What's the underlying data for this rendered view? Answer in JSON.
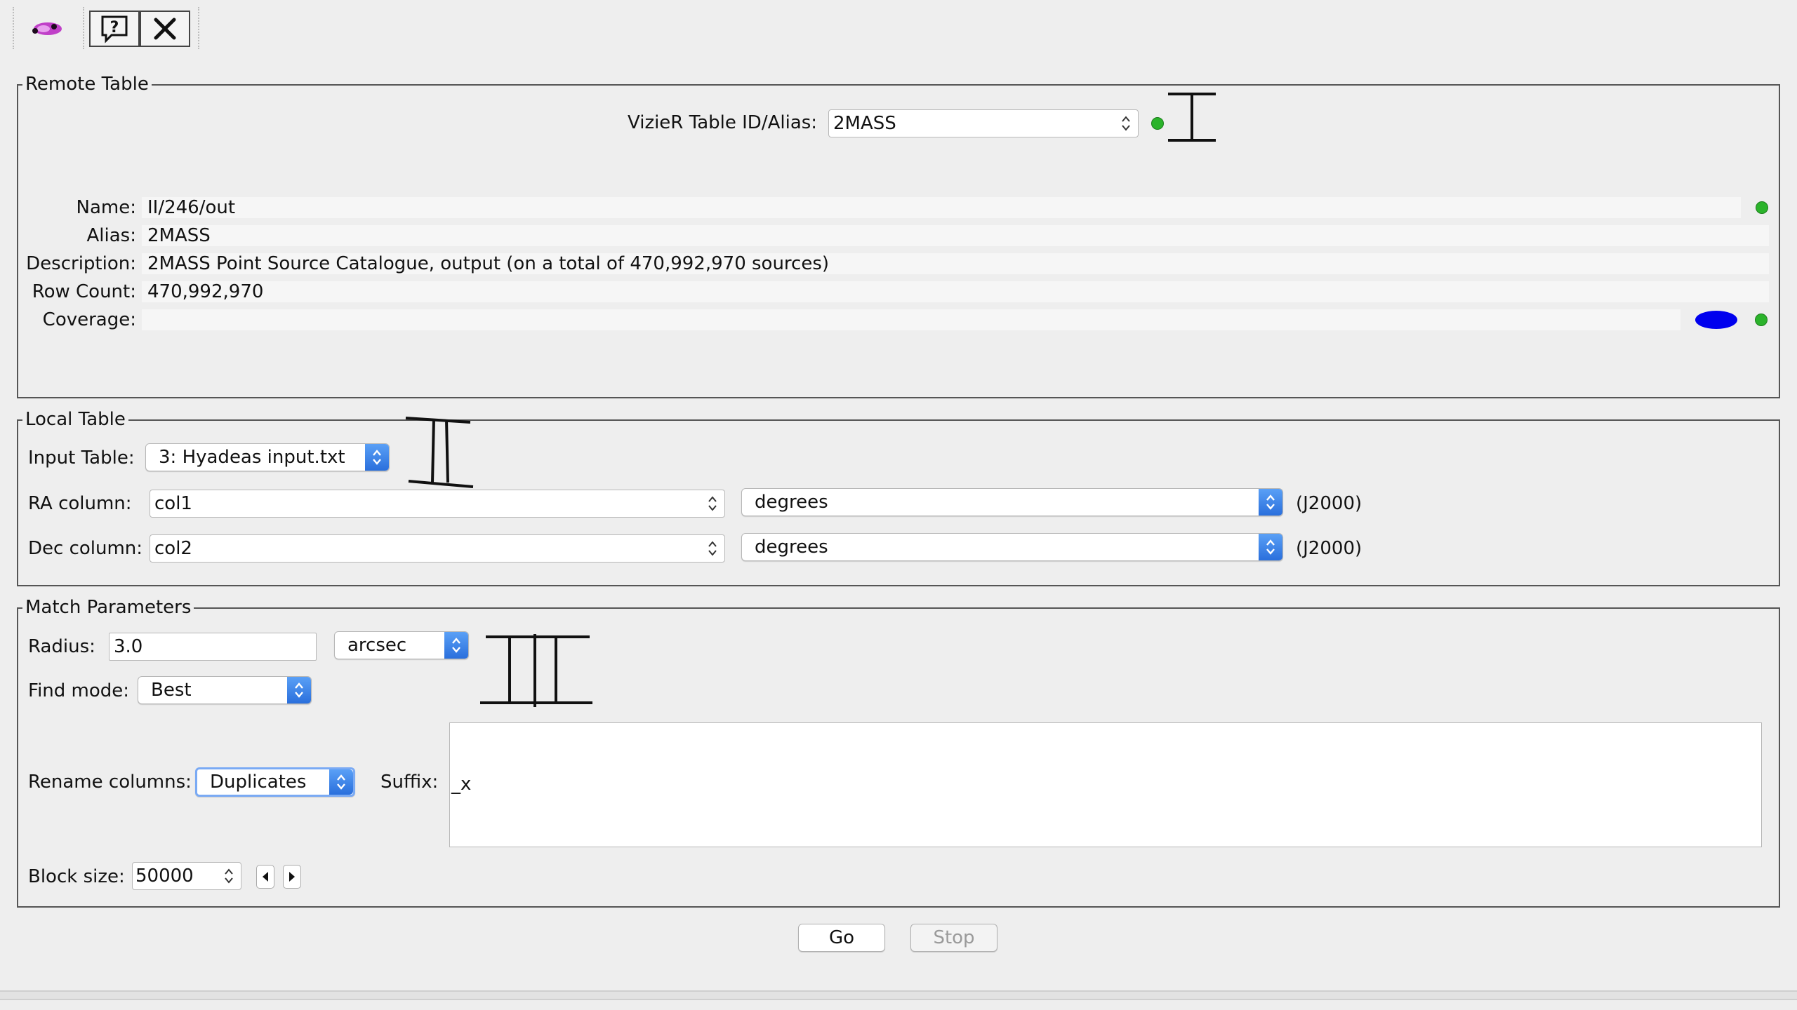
{
  "toolbar": {
    "logo_icon": "topcat-logo-icon",
    "help_icon": "help-icon",
    "close_icon": "close-icon"
  },
  "remote_table": {
    "legend": "Remote Table",
    "id_label": "VizieR Table ID/Alias:",
    "id_value": "2MASS",
    "name_label": "Name:",
    "name_value": "II/246/out",
    "alias_label": "Alias:",
    "alias_value": "2MASS",
    "description_label": "Description:",
    "description_value": "2MASS Point Source Catalogue, output (on a total of 470,992,970 sources)",
    "row_count_label": "Row Count:",
    "row_count_value": "470,992,970",
    "coverage_label": "Coverage:",
    "coverage_value": ""
  },
  "local_table": {
    "legend": "Local Table",
    "input_label": "Input Table:",
    "input_value": "3: Hyadeas input.txt",
    "ra_label": "RA column:",
    "ra_value": "col1",
    "ra_unit": "degrees",
    "ra_epoch": "(J2000)",
    "dec_label": "Dec column:",
    "dec_value": "col2",
    "dec_unit": "degrees",
    "dec_epoch": "(J2000)"
  },
  "match": {
    "legend": "Match Parameters",
    "radius_label": "Radius:",
    "radius_value": "3.0",
    "radius_unit": "arcsec",
    "find_label": "Find mode:",
    "find_value": "Best",
    "rename_label": "Rename columns:",
    "rename_value": "Duplicates",
    "suffix_label": "Suffix:",
    "suffix_value": "_x",
    "block_label": "Block size:",
    "block_value": "50000"
  },
  "actions": {
    "go": "Go",
    "stop": "Stop"
  },
  "colors": {
    "status_ok": "#2bb32b",
    "coverage_blue": "#0000ee",
    "combo_blue": "#2a6fdc"
  }
}
